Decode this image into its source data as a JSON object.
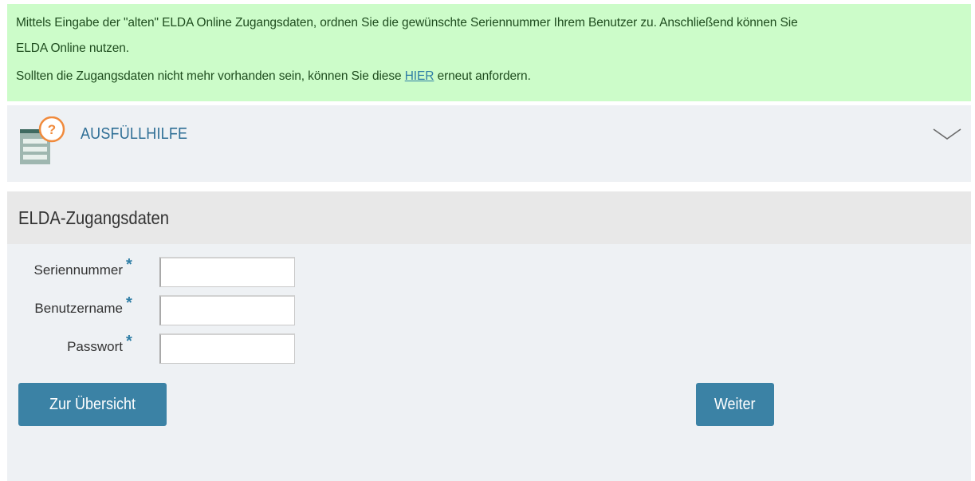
{
  "notice": {
    "line1": "Mittels Eingabe der \"alten\" ELDA Online Zugangsdaten, ordnen Sie die gewünschte Seriennummer Ihrem Benutzer zu. Anschließend können Sie",
    "line2": "ELDA Online nutzen.",
    "line3_before": "Sollten die Zugangsdaten nicht mehr vorhanden sein, können Sie diese ",
    "link": "HIER",
    "line3_after": " erneut anfordern."
  },
  "help": {
    "label": "AUSFÜLLHILFE",
    "icon": "help-form-icon",
    "icon_glyph": "?",
    "accent_color": "#f08a3c"
  },
  "form": {
    "title": "ELDA-Zugangsdaten",
    "fields": [
      {
        "label": "Seriennummer",
        "required": "*",
        "value": ""
      },
      {
        "label": "Benutzername",
        "required": "*",
        "value": ""
      },
      {
        "label": "Passwort",
        "required": "*",
        "value": ""
      }
    ]
  },
  "buttons": {
    "overview": "Zur Übersicht",
    "next": "Weiter"
  },
  "colors": {
    "notice_bg": "#ccfcc9",
    "notice_text": "#1f4d1f",
    "link": "#2f7ea6",
    "panel_bg": "#eef1f4",
    "button_bg": "#3b82a5"
  }
}
